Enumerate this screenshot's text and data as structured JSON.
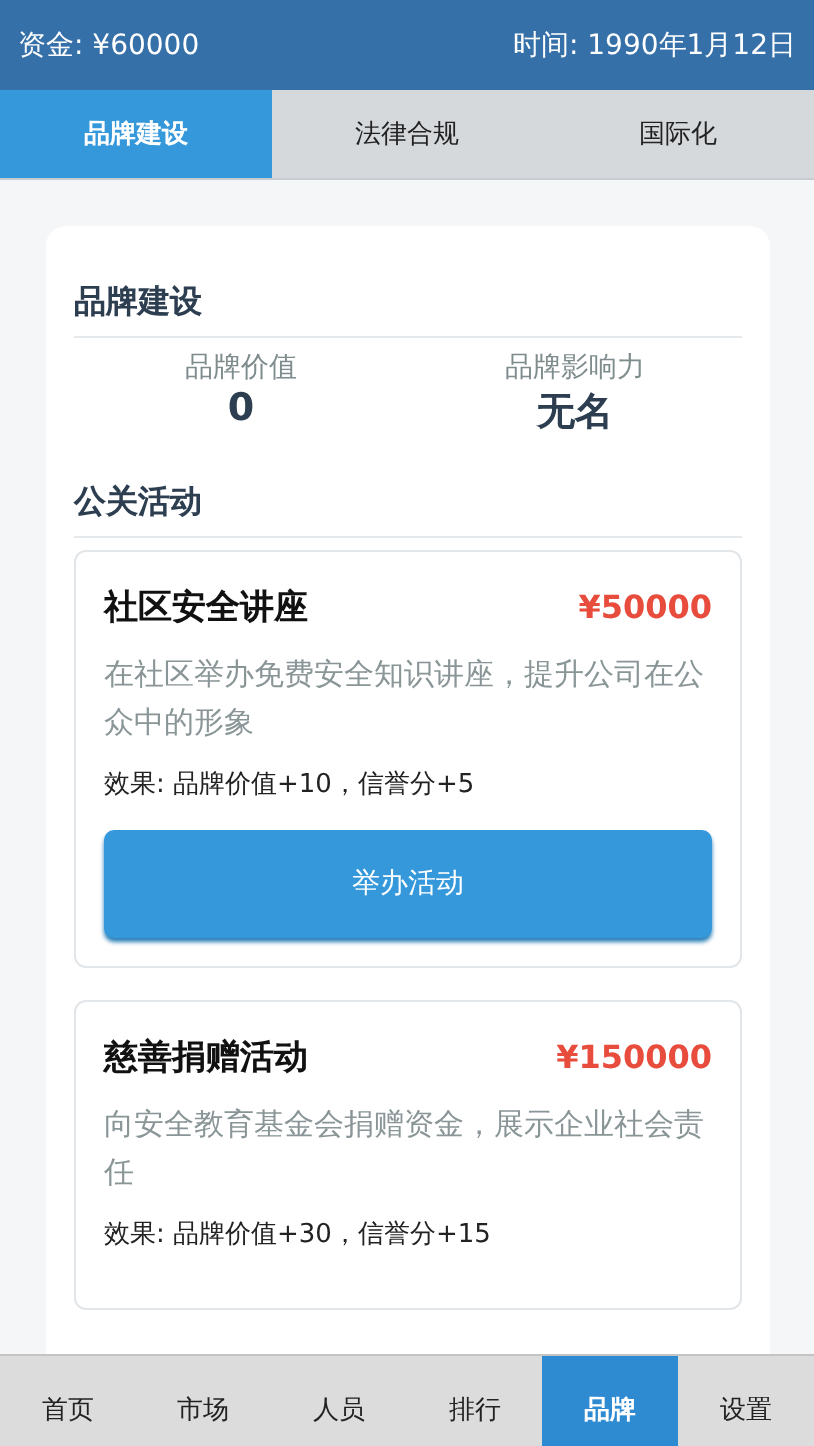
{
  "header": {
    "funds": "资金: ¥60000",
    "date": "时间: 1990年1月12日"
  },
  "tabs": [
    {
      "label": "品牌建设",
      "selected": true
    },
    {
      "label": "法律合规",
      "selected": false
    },
    {
      "label": "国际化",
      "selected": false
    }
  ],
  "brand": {
    "title": "品牌建设",
    "stats": [
      {
        "label": "品牌价值",
        "value": "0"
      },
      {
        "label": "品牌影响力",
        "value": "无名"
      }
    ]
  },
  "pr": {
    "title": "公关活动",
    "activities": [
      {
        "name": "社区安全讲座",
        "cost": "¥50000",
        "description": "在社区举办免费安全知识讲座，提升公司在公众中的形象",
        "effect": "效果: 品牌价值+10，信誉分+5",
        "button": "举办活动"
      },
      {
        "name": "慈善捐赠活动",
        "cost": "¥150000",
        "description": "向安全教育基金会捐赠资金，展示企业社会责任",
        "effect": "效果: 品牌价值+30，信誉分+15"
      }
    ]
  },
  "nav": [
    {
      "label": "首页",
      "selected": false
    },
    {
      "label": "市场",
      "selected": false
    },
    {
      "label": "人员",
      "selected": false
    },
    {
      "label": "排行",
      "selected": false
    },
    {
      "label": "品牌",
      "selected": true
    },
    {
      "label": "设置",
      "selected": false
    }
  ]
}
